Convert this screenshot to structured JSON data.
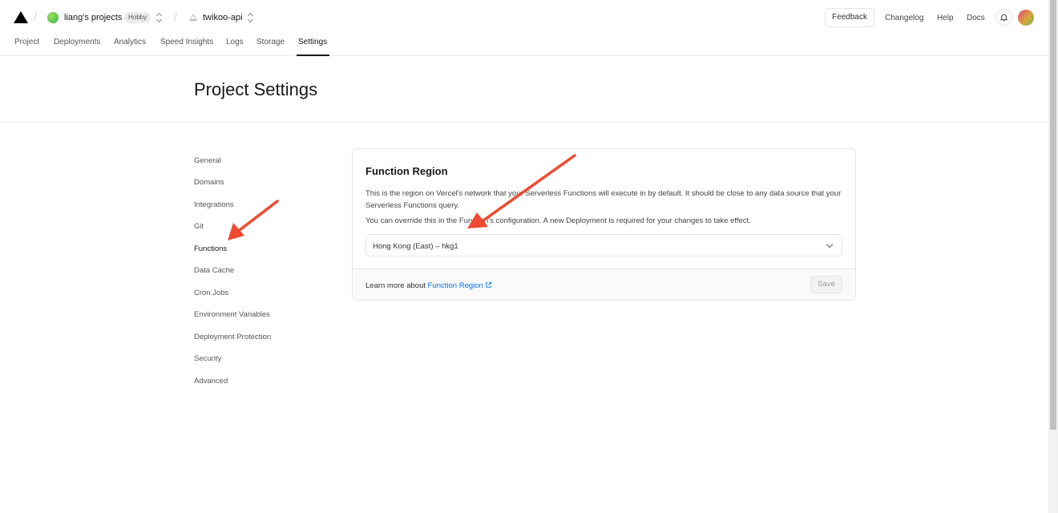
{
  "header": {
    "team_name": "liang's projects",
    "plan_badge": "Hobby",
    "project_name": "twikoo-api",
    "feedback_label": "Feedback",
    "links": [
      "Changelog",
      "Help",
      "Docs"
    ]
  },
  "tabs": [
    "Project",
    "Deployments",
    "Analytics",
    "Speed Insights",
    "Logs",
    "Storage",
    "Settings"
  ],
  "active_tab": "Settings",
  "page": {
    "title": "Project Settings"
  },
  "sidebar": {
    "items": [
      "General",
      "Domains",
      "Integrations",
      "Git",
      "Functions",
      "Data Cache",
      "Cron Jobs",
      "Environment Variables",
      "Deployment Protection",
      "Security",
      "Advanced"
    ],
    "active": "Functions"
  },
  "card": {
    "title": "Function Region",
    "description": "This is the region on Vercel's network that your Serverless Functions will execute in by default. It should be close to any data source that your Serverless Functions query.",
    "description2": "You can override this in the Function's configuration. A new Deployment is required for your changes to take effect.",
    "region_value": "Hong Kong (East) – hkg1",
    "footer_text": "Learn more about ",
    "footer_link": "Function Region",
    "save_label": "Save"
  },
  "colors": {
    "link": "#0070f3",
    "annotation_arrow": "#f04a32"
  },
  "icons": [
    "vercel-logo-icon",
    "chevron-updown-icon",
    "project-triangle-icon",
    "bell-icon",
    "chevron-down-icon",
    "external-link-icon"
  ]
}
